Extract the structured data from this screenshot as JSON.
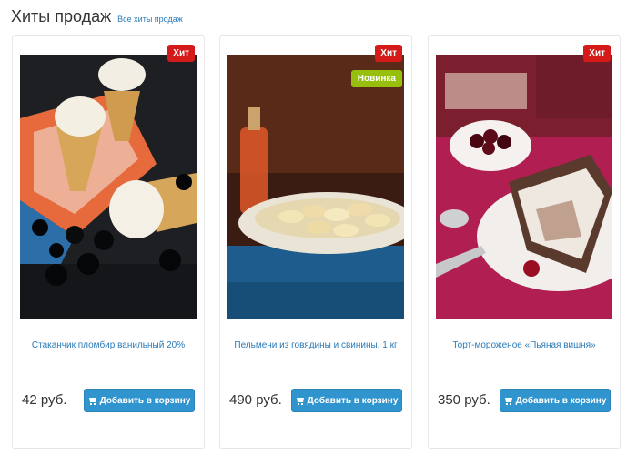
{
  "section": {
    "title": "Хиты продаж",
    "all_link": "Все хиты продаж"
  },
  "products": [
    {
      "name": "Стаканчик пломбир ванильный 20%",
      "price": "42 руб.",
      "badges": [
        "Хит"
      ],
      "button": "Добавить в корзину",
      "image": "ice-cream-cones-photo"
    },
    {
      "name": "Пельмени из говядины и свинины, 1 кг",
      "price": "490 руб.",
      "badges": [
        "Хит",
        "Новинка"
      ],
      "button": "Добавить в корзину",
      "image": "dumplings-plate-photo"
    },
    {
      "name": "Торт-мороженое «Пьяная вишня»",
      "price": "350 руб.",
      "badges": [
        "Хит"
      ],
      "button": "Добавить в корзину",
      "image": "ice-cream-cake-photo"
    }
  ],
  "colors": {
    "accent": "#3094cf",
    "link": "#2a7ab8",
    "badge_hit": "#d51a1a",
    "badge_new": "#97bf0d"
  }
}
